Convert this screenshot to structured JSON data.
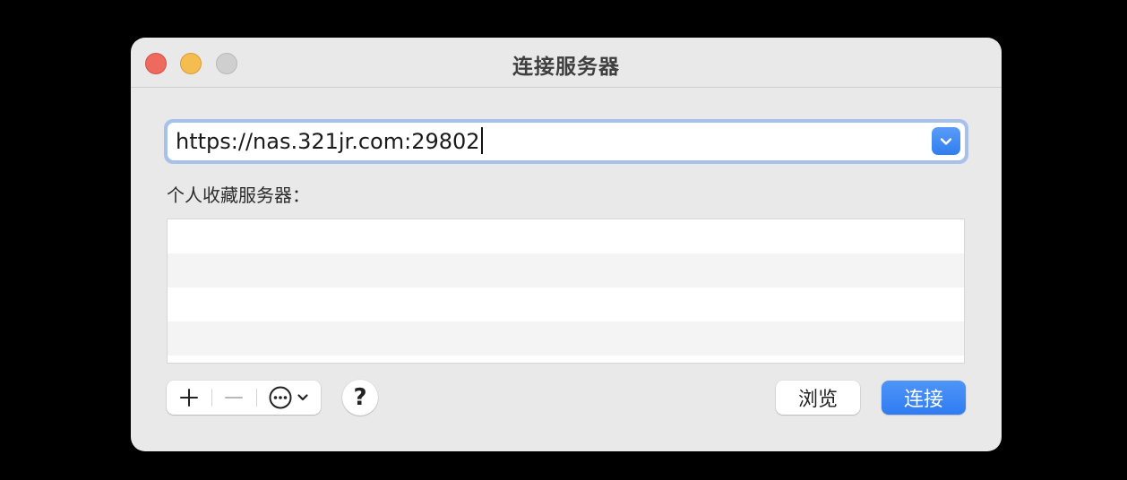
{
  "window": {
    "title": "连接服务器"
  },
  "server_address": {
    "value": "https://nas.321jr.com:29802",
    "dropdown_icon": "chevron-down-icon"
  },
  "favorites": {
    "label": "个人收藏服务器：",
    "items": []
  },
  "toolbar": {
    "add_icon": "plus-icon",
    "remove_icon": "minus-icon",
    "more_icon": "ellipsis-circle-icon",
    "help_label": "?"
  },
  "buttons": {
    "browse_label": "浏览",
    "connect_label": "连接"
  },
  "colors": {
    "accent": "#3b82f6",
    "close": "#ee6a5e",
    "minimize": "#f5bd4f",
    "zoom_disabled": "#cfcfcf"
  }
}
